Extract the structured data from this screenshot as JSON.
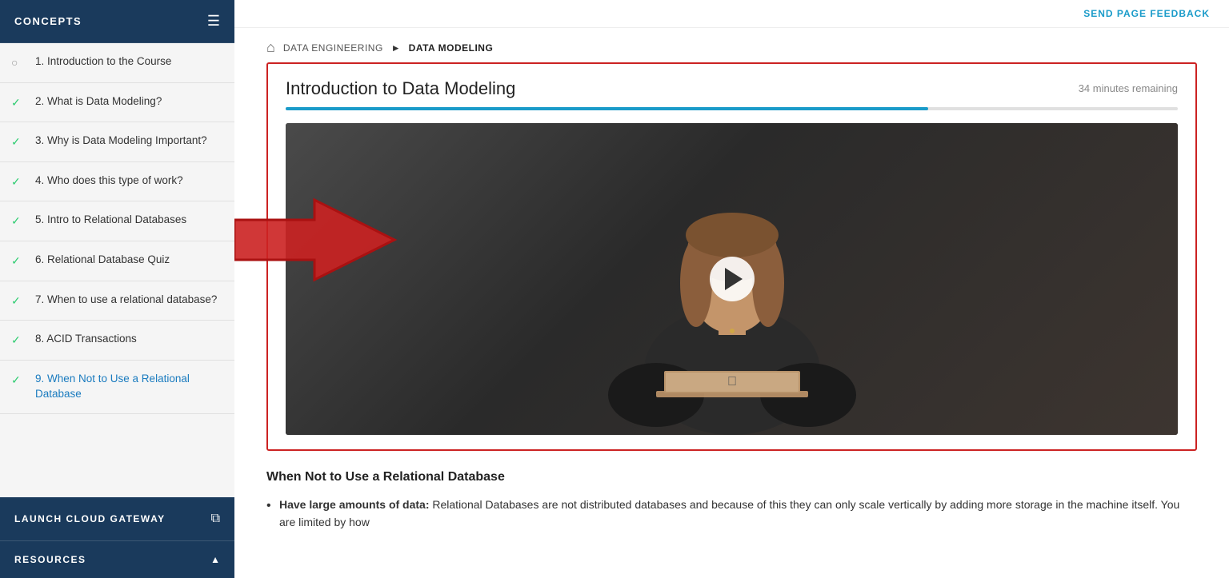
{
  "sidebar": {
    "title": "CONCEPTS",
    "toggle_icon": "≡",
    "items": [
      {
        "id": 1,
        "label": "1. Introduction to the Course",
        "status": "circle",
        "active": false
      },
      {
        "id": 2,
        "label": "2. What is Data Modeling?",
        "status": "check",
        "active": false
      },
      {
        "id": 3,
        "label": "3. Why is Data Modeling Important?",
        "status": "check",
        "active": false
      },
      {
        "id": 4,
        "label": "4. Who does this type of work?",
        "status": "check",
        "active": false
      },
      {
        "id": 5,
        "label": "5. Intro to Relational Databases",
        "status": "check",
        "active": false
      },
      {
        "id": 6,
        "label": "6. Relational Database Quiz",
        "status": "check",
        "active": false
      },
      {
        "id": 7,
        "label": "7. When to use a relational database?",
        "status": "check",
        "active": false
      },
      {
        "id": 8,
        "label": "8. ACID Transactions",
        "status": "check",
        "active": false
      },
      {
        "id": 9,
        "label": "9. When Not to Use a Relational Database",
        "status": "check",
        "active": true
      }
    ],
    "launch_gateway": {
      "label": "LAUNCH CLOUD GATEWAY",
      "icon": "⧉"
    },
    "resources": {
      "label": "RESOURCES",
      "icon": "▲"
    }
  },
  "topbar": {
    "feedback_label": "SEND PAGE FEEDBACK"
  },
  "breadcrumb": {
    "home_icon": "⌂",
    "items": [
      {
        "label": "DATA ENGINEERING",
        "active": false
      },
      {
        "label": "DATA MODELING",
        "active": true
      }
    ],
    "separator": "▶"
  },
  "video_card": {
    "title": "Introduction to Data Modeling",
    "time_remaining": "34 minutes remaining",
    "progress_percent": 72
  },
  "below_video": {
    "title": "When Not to Use a Relational Database",
    "bullets": [
      {
        "bold_part": "Have large amounts of data:",
        "text": " Relational Databases are not distributed databases and because of this they can only scale vertically by adding more storage in the machine itself. You are limited by how"
      }
    ]
  }
}
